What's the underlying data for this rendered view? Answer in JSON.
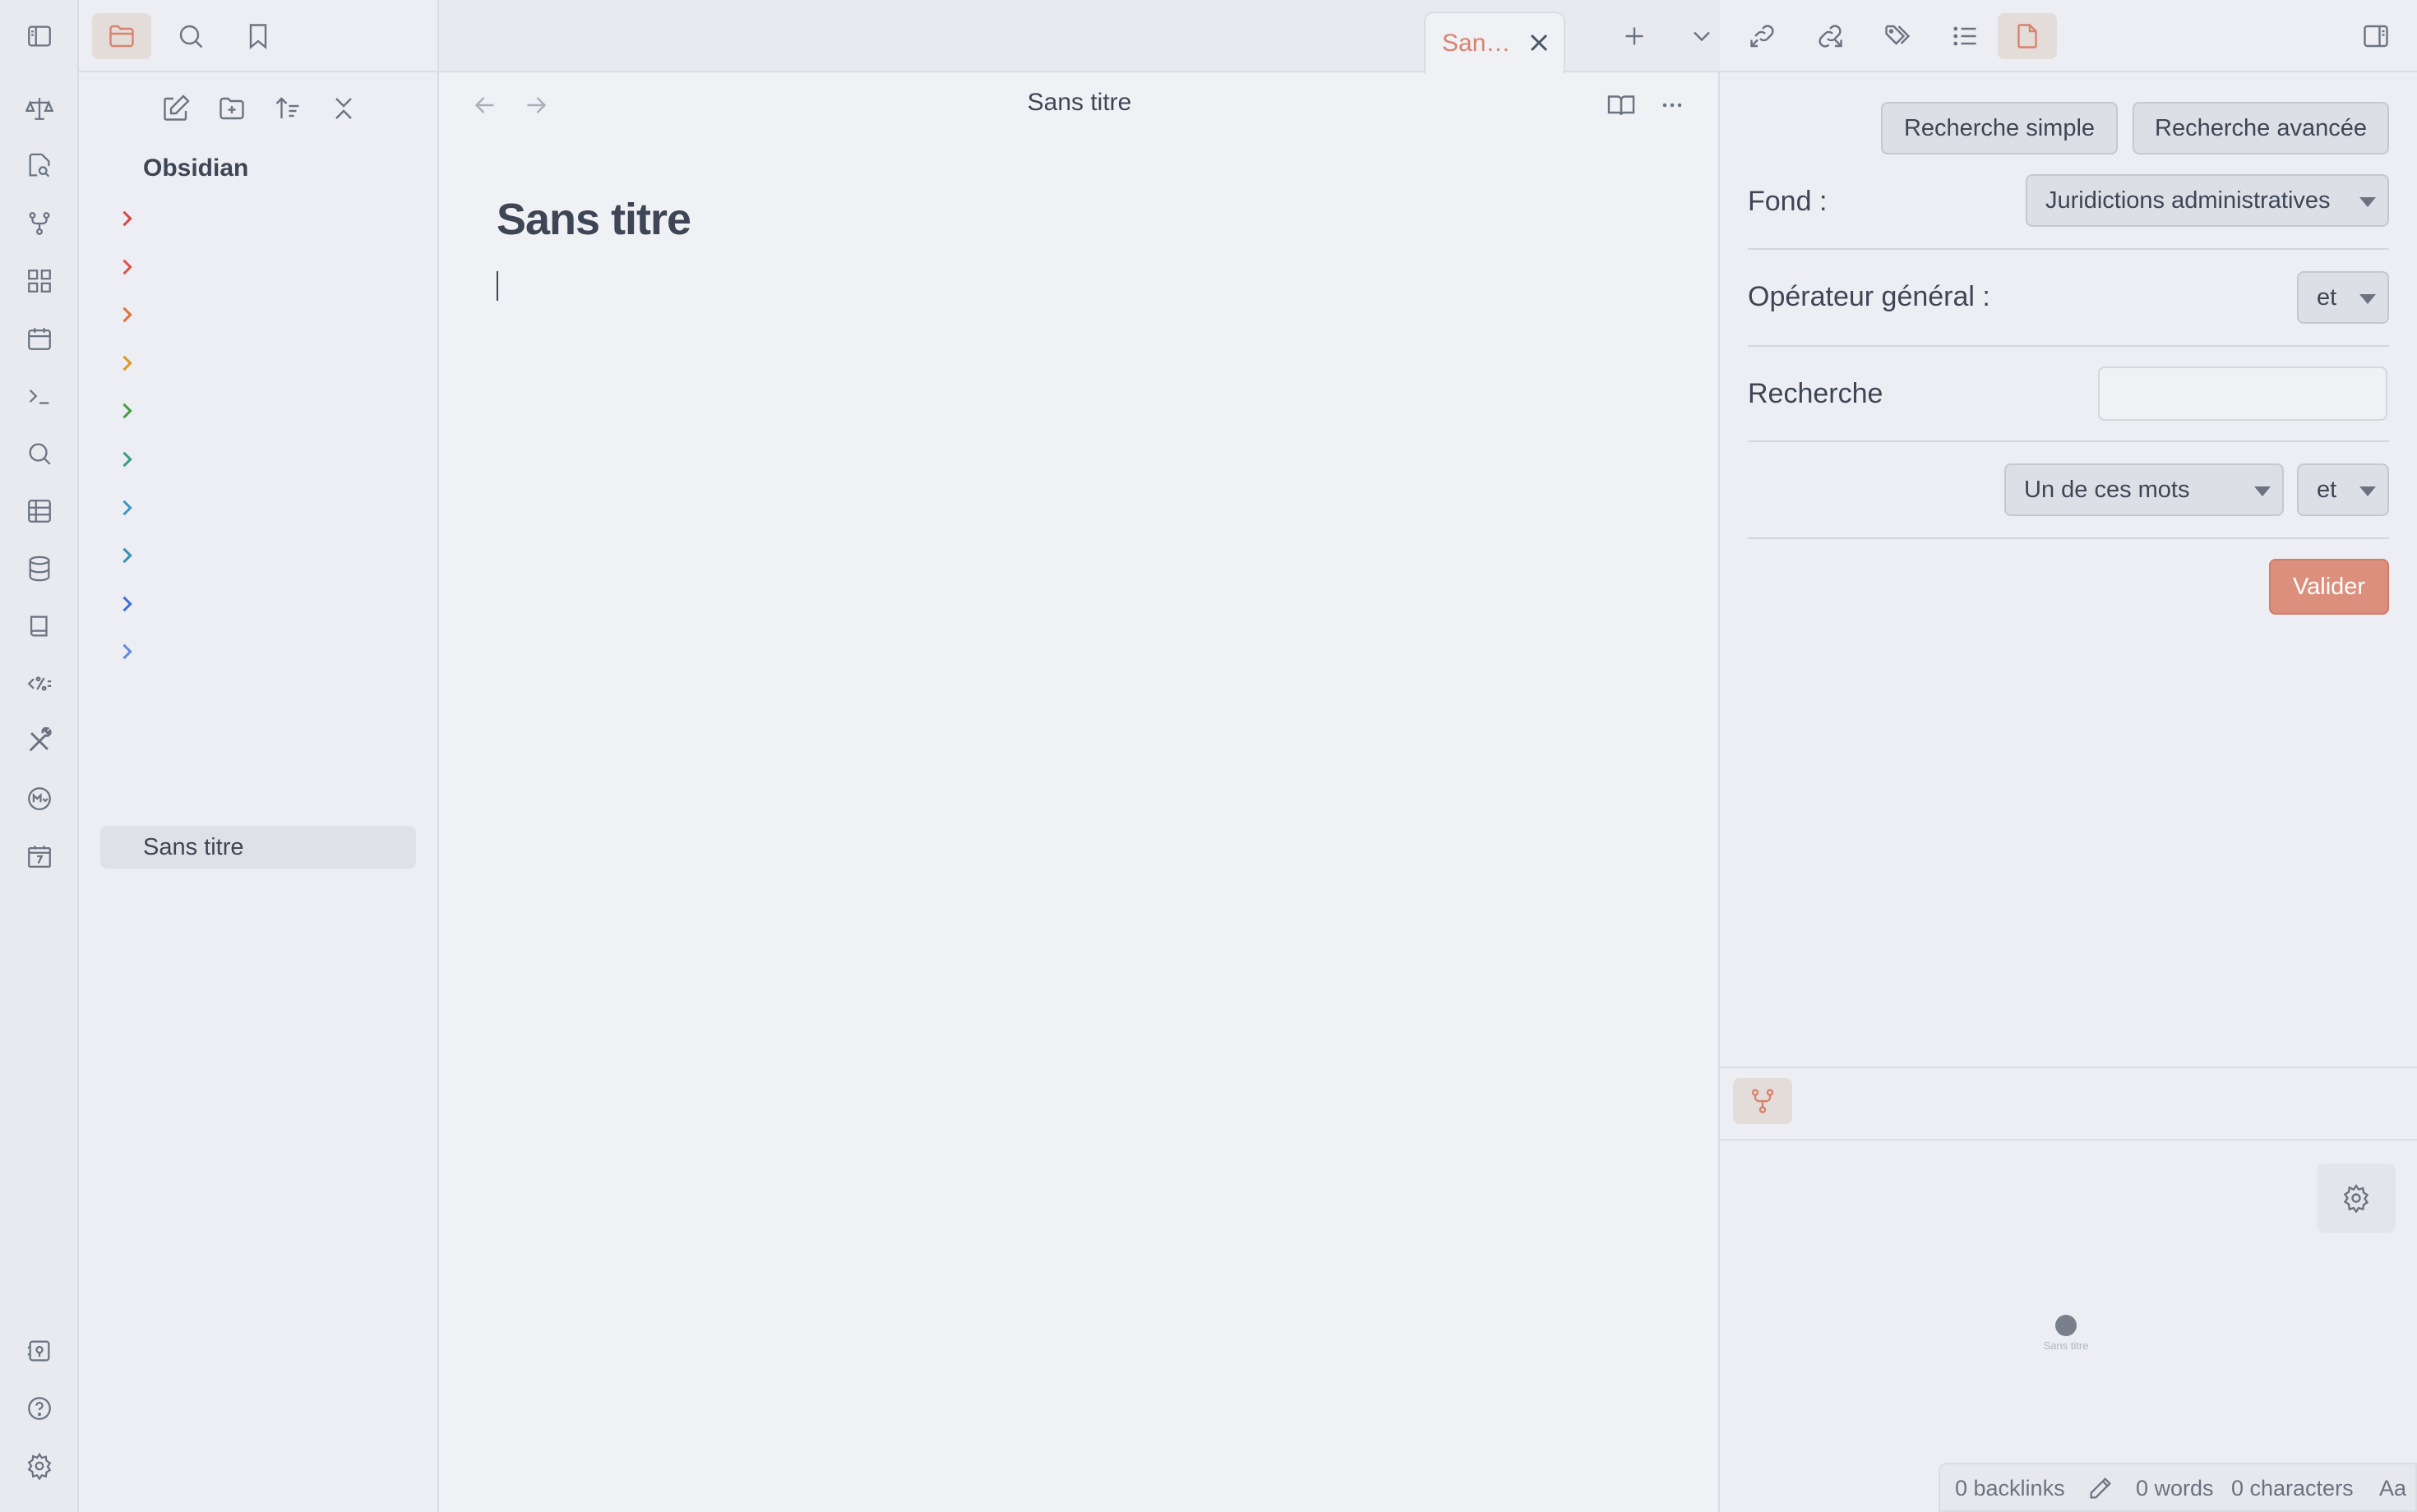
{
  "ribbon": {
    "icons": [
      "scale-icon",
      "file-search-icon",
      "graph-icon",
      "dashboard-icon",
      "calendar-icon",
      "terminal-icon",
      "search-icon",
      "table-icon",
      "database-icon",
      "book-icon",
      "templater-icon",
      "tools-icon",
      "markdown-icon",
      "daily-calendar-icon"
    ],
    "bottom_icons": [
      "vault-switch-icon",
      "help-icon",
      "settings-icon"
    ]
  },
  "left_sidebar": {
    "vault_name": "Obsidian",
    "folder_colors": [
      "#d84848",
      "#d8544a",
      "#e0723a",
      "#d99a2b",
      "#4a9e3f",
      "#3e9a86",
      "#3f96c4",
      "#3a8fb0",
      "#3f6fd6",
      "#6a8ad8"
    ],
    "file": "Sans titre"
  },
  "main": {
    "tab_title": "San…",
    "view_title": "Sans titre",
    "doc_title": "Sans titre"
  },
  "right_panel": {
    "btn_simple": "Recherche simple",
    "btn_avancee": "Recherche avancée",
    "fond_label": "Fond :",
    "fond_value": "Juridictions administratives",
    "operateur_label": "Opérateur général :",
    "operateur_value": "et",
    "recherche_label": "Recherche",
    "recherche_value": "",
    "mode_value": "Un de ces mots",
    "mode_op_value": "et",
    "valider": "Valider",
    "graph_node_label": "Sans titre"
  },
  "status_bar": {
    "backlinks": "0 backlinks",
    "words": "0 words",
    "characters": "0 characters",
    "aa": "Aa"
  },
  "colors": {
    "accent": "#d9826e",
    "valider_bg": "#db8f7c"
  }
}
